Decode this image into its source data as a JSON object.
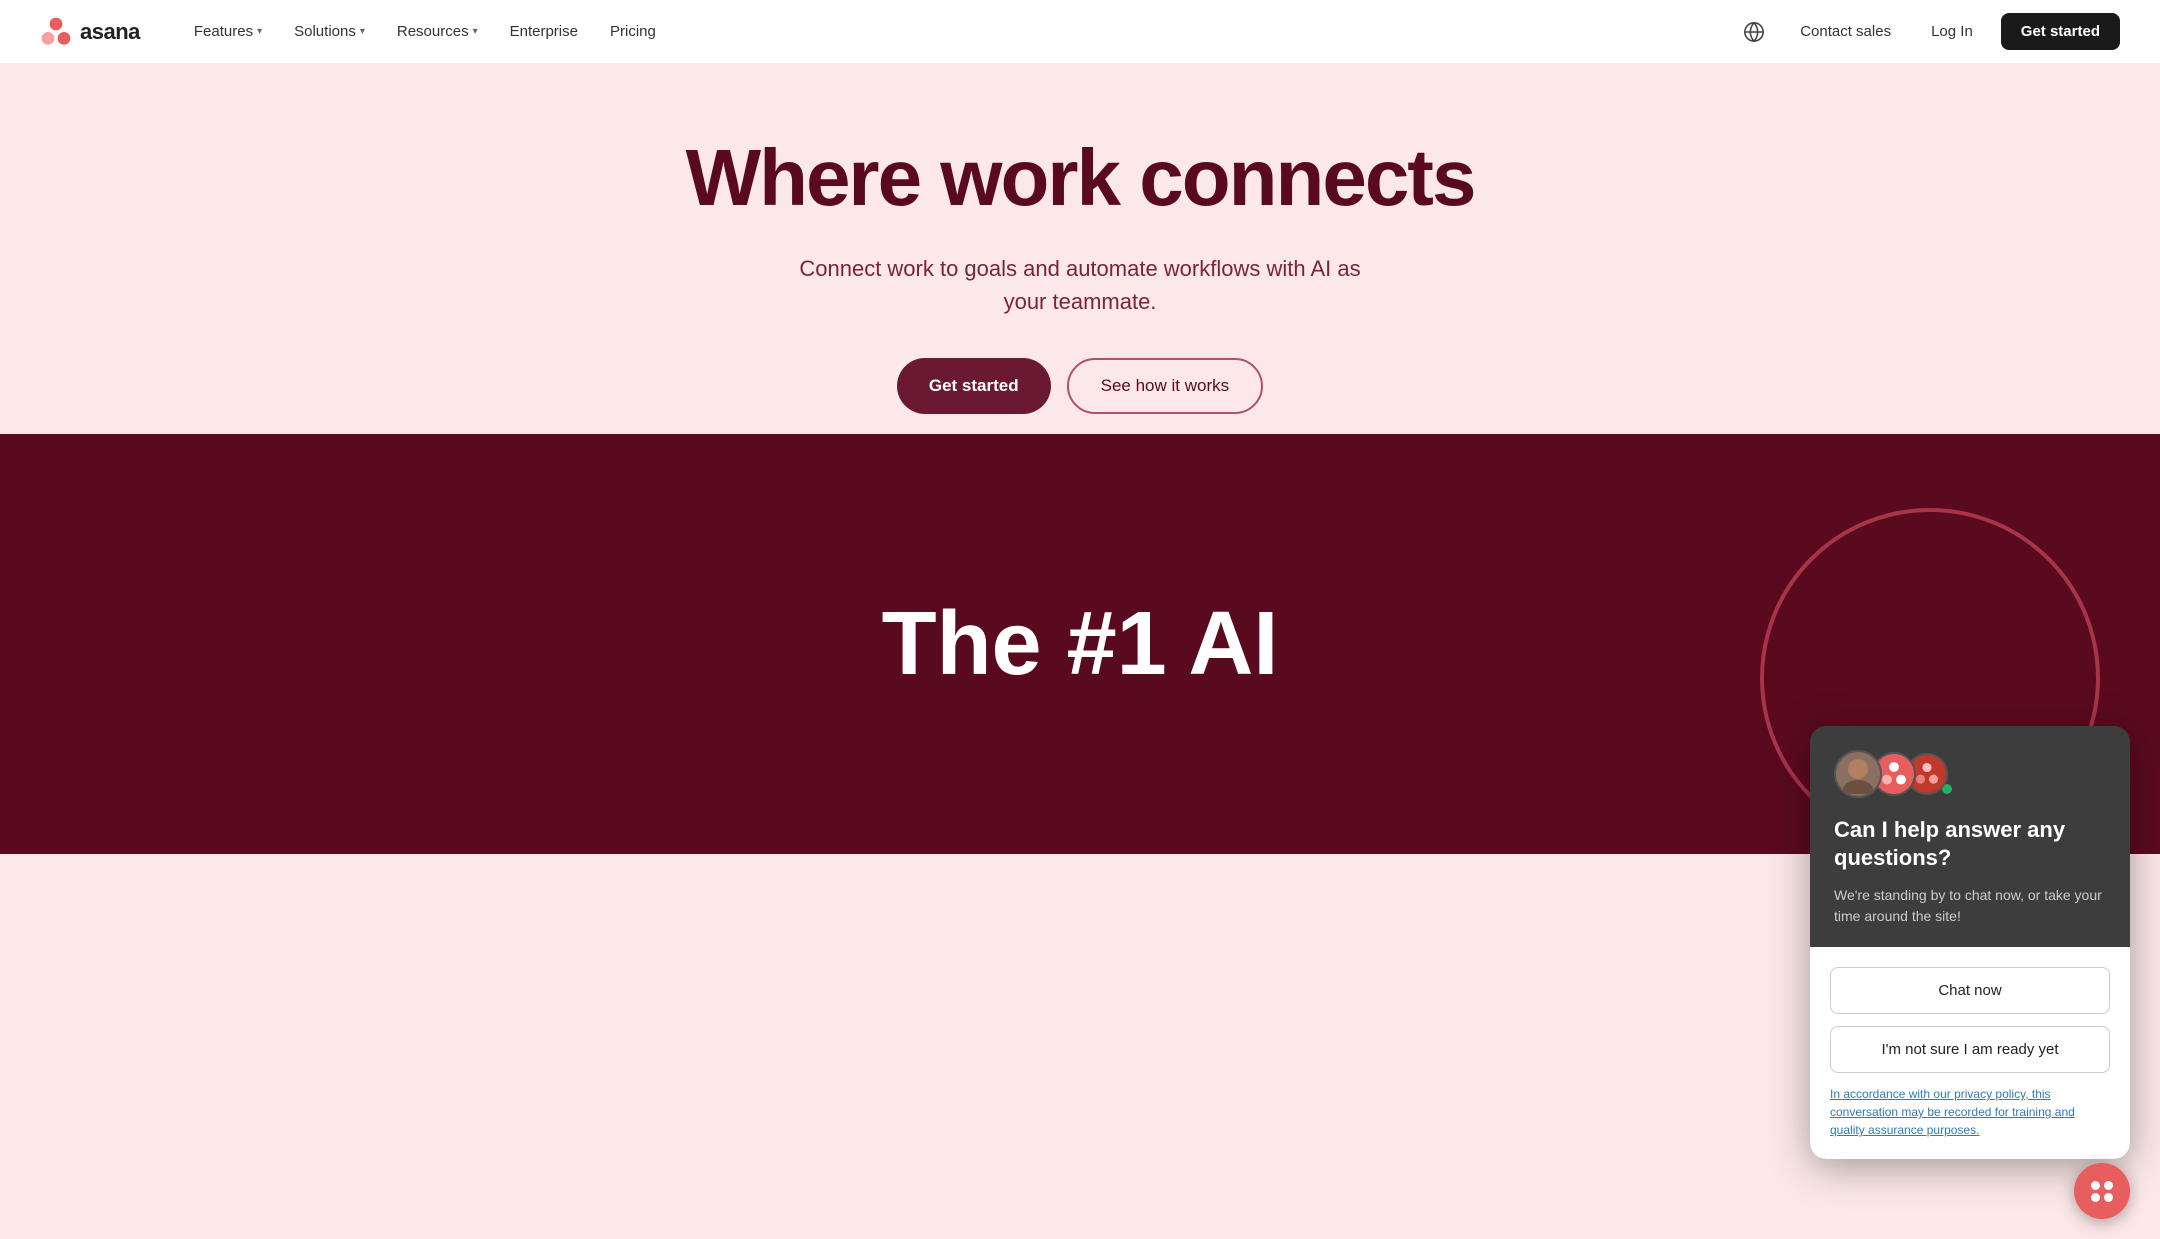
{
  "nav": {
    "logo_text": "asana",
    "links": [
      {
        "label": "Features",
        "has_dropdown": true
      },
      {
        "label": "Solutions",
        "has_dropdown": true
      },
      {
        "label": "Resources",
        "has_dropdown": true
      },
      {
        "label": "Enterprise",
        "has_dropdown": false
      },
      {
        "label": "Pricing",
        "has_dropdown": false
      }
    ],
    "contact_sales": "Contact sales",
    "log_in": "Log In",
    "get_started": "Get started"
  },
  "hero": {
    "title": "Where work connects",
    "subtitle": "Connect work to goals and automate workflows with AI as your teammate.",
    "btn_primary": "Get started",
    "btn_secondary": "See how it works"
  },
  "dark_section": {
    "text": "The #1 AI"
  },
  "chat_widget": {
    "title": "Can I help answer any questions?",
    "subtitle": "We're standing by to chat now, or take your time around the site!",
    "btn_chat_now": "Chat now",
    "btn_not_ready": "I'm not sure I am ready yet",
    "privacy_text": "In accordance with our privacy policy, this conversation may be recorded for training and quality assurance purposes."
  }
}
